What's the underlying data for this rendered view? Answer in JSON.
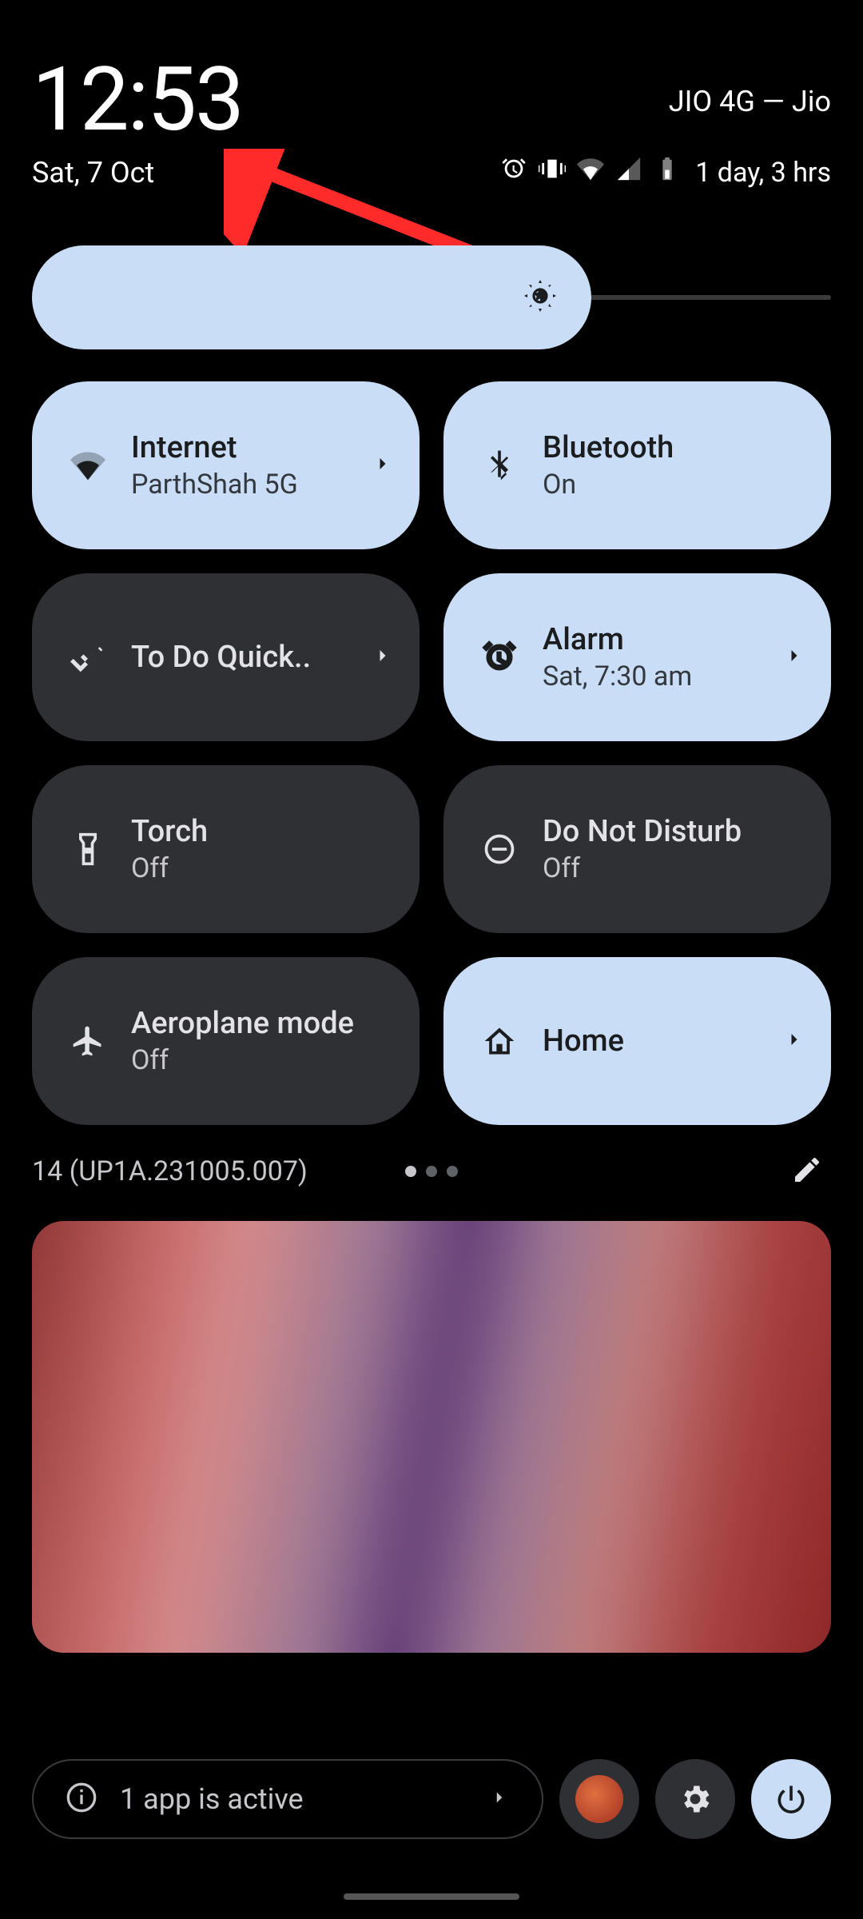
{
  "header": {
    "time": "12:53",
    "date": "Sat, 7 Oct",
    "carrier": "JIO 4G — Jio",
    "battery_text": "1 day, 3 hrs"
  },
  "tiles": [
    {
      "title": "Internet",
      "sub": "ParthShah 5G",
      "state": "on",
      "icon": "wifi",
      "chevron": true
    },
    {
      "title": "Bluetooth",
      "sub": "On",
      "state": "on",
      "icon": "bluetooth",
      "chevron": false
    },
    {
      "title": "To Do Quick..",
      "sub": "",
      "state": "off",
      "icon": "check",
      "chevron": true
    },
    {
      "title": "Alarm",
      "sub": "Sat, 7:30 am",
      "state": "on",
      "icon": "alarm",
      "chevron": true
    },
    {
      "title": "Torch",
      "sub": "Off",
      "state": "off",
      "icon": "torch",
      "chevron": false
    },
    {
      "title": "Do Not Disturb",
      "sub": "Off",
      "state": "off",
      "icon": "dnd",
      "chevron": false
    },
    {
      "title": "Aeroplane mode",
      "sub": "Off",
      "state": "off",
      "icon": "airplane",
      "chevron": false
    },
    {
      "title": "Home",
      "sub": "",
      "state": "on",
      "icon": "home",
      "chevron": true
    }
  ],
  "footer": {
    "build": "14 (UP1A.231005.007)",
    "active_apps": "1 app is active"
  }
}
